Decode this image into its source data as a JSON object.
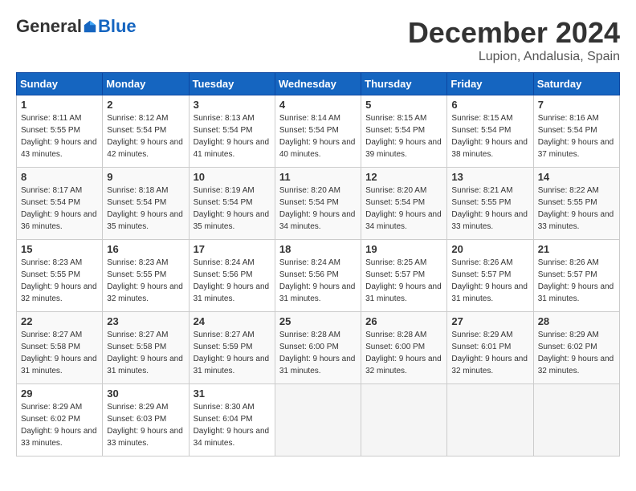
{
  "header": {
    "logo_general": "General",
    "logo_blue": "Blue",
    "month_title": "December 2024",
    "location": "Lupion, Andalusia, Spain"
  },
  "weekdays": [
    "Sunday",
    "Monday",
    "Tuesday",
    "Wednesday",
    "Thursday",
    "Friday",
    "Saturday"
  ],
  "weeks": [
    [
      {
        "day": "1",
        "sunrise": "8:11 AM",
        "sunset": "5:55 PM",
        "daylight": "9 hours and 43 minutes."
      },
      {
        "day": "2",
        "sunrise": "8:12 AM",
        "sunset": "5:54 PM",
        "daylight": "9 hours and 42 minutes."
      },
      {
        "day": "3",
        "sunrise": "8:13 AM",
        "sunset": "5:54 PM",
        "daylight": "9 hours and 41 minutes."
      },
      {
        "day": "4",
        "sunrise": "8:14 AM",
        "sunset": "5:54 PM",
        "daylight": "9 hours and 40 minutes."
      },
      {
        "day": "5",
        "sunrise": "8:15 AM",
        "sunset": "5:54 PM",
        "daylight": "9 hours and 39 minutes."
      },
      {
        "day": "6",
        "sunrise": "8:15 AM",
        "sunset": "5:54 PM",
        "daylight": "9 hours and 38 minutes."
      },
      {
        "day": "7",
        "sunrise": "8:16 AM",
        "sunset": "5:54 PM",
        "daylight": "9 hours and 37 minutes."
      }
    ],
    [
      {
        "day": "8",
        "sunrise": "8:17 AM",
        "sunset": "5:54 PM",
        "daylight": "9 hours and 36 minutes."
      },
      {
        "day": "9",
        "sunrise": "8:18 AM",
        "sunset": "5:54 PM",
        "daylight": "9 hours and 35 minutes."
      },
      {
        "day": "10",
        "sunrise": "8:19 AM",
        "sunset": "5:54 PM",
        "daylight": "9 hours and 35 minutes."
      },
      {
        "day": "11",
        "sunrise": "8:20 AM",
        "sunset": "5:54 PM",
        "daylight": "9 hours and 34 minutes."
      },
      {
        "day": "12",
        "sunrise": "8:20 AM",
        "sunset": "5:54 PM",
        "daylight": "9 hours and 34 minutes."
      },
      {
        "day": "13",
        "sunrise": "8:21 AM",
        "sunset": "5:55 PM",
        "daylight": "9 hours and 33 minutes."
      },
      {
        "day": "14",
        "sunrise": "8:22 AM",
        "sunset": "5:55 PM",
        "daylight": "9 hours and 33 minutes."
      }
    ],
    [
      {
        "day": "15",
        "sunrise": "8:23 AM",
        "sunset": "5:55 PM",
        "daylight": "9 hours and 32 minutes."
      },
      {
        "day": "16",
        "sunrise": "8:23 AM",
        "sunset": "5:55 PM",
        "daylight": "9 hours and 32 minutes."
      },
      {
        "day": "17",
        "sunrise": "8:24 AM",
        "sunset": "5:56 PM",
        "daylight": "9 hours and 31 minutes."
      },
      {
        "day": "18",
        "sunrise": "8:24 AM",
        "sunset": "5:56 PM",
        "daylight": "9 hours and 31 minutes."
      },
      {
        "day": "19",
        "sunrise": "8:25 AM",
        "sunset": "5:57 PM",
        "daylight": "9 hours and 31 minutes."
      },
      {
        "day": "20",
        "sunrise": "8:26 AM",
        "sunset": "5:57 PM",
        "daylight": "9 hours and 31 minutes."
      },
      {
        "day": "21",
        "sunrise": "8:26 AM",
        "sunset": "5:57 PM",
        "daylight": "9 hours and 31 minutes."
      }
    ],
    [
      {
        "day": "22",
        "sunrise": "8:27 AM",
        "sunset": "5:58 PM",
        "daylight": "9 hours and 31 minutes."
      },
      {
        "day": "23",
        "sunrise": "8:27 AM",
        "sunset": "5:58 PM",
        "daylight": "9 hours and 31 minutes."
      },
      {
        "day": "24",
        "sunrise": "8:27 AM",
        "sunset": "5:59 PM",
        "daylight": "9 hours and 31 minutes."
      },
      {
        "day": "25",
        "sunrise": "8:28 AM",
        "sunset": "6:00 PM",
        "daylight": "9 hours and 31 minutes."
      },
      {
        "day": "26",
        "sunrise": "8:28 AM",
        "sunset": "6:00 PM",
        "daylight": "9 hours and 32 minutes."
      },
      {
        "day": "27",
        "sunrise": "8:29 AM",
        "sunset": "6:01 PM",
        "daylight": "9 hours and 32 minutes."
      },
      {
        "day": "28",
        "sunrise": "8:29 AM",
        "sunset": "6:02 PM",
        "daylight": "9 hours and 32 minutes."
      }
    ],
    [
      {
        "day": "29",
        "sunrise": "8:29 AM",
        "sunset": "6:02 PM",
        "daylight": "9 hours and 33 minutes."
      },
      {
        "day": "30",
        "sunrise": "8:29 AM",
        "sunset": "6:03 PM",
        "daylight": "9 hours and 33 minutes."
      },
      {
        "day": "31",
        "sunrise": "8:30 AM",
        "sunset": "6:04 PM",
        "daylight": "9 hours and 34 minutes."
      },
      null,
      null,
      null,
      null
    ]
  ]
}
